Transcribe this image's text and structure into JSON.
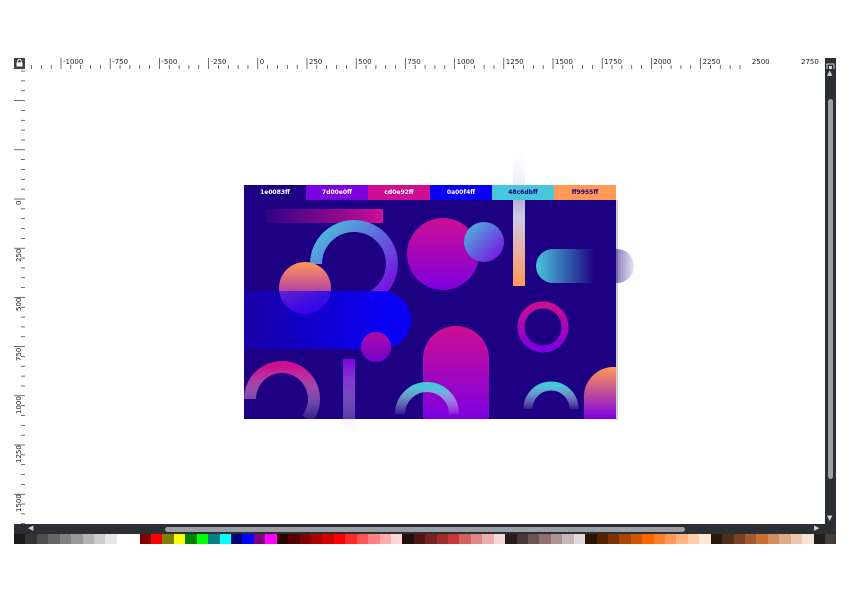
{
  "ruler": {
    "h_labels": [
      "-1000",
      "-750",
      "-500",
      "-250",
      "0",
      "250",
      "500",
      "750",
      "1000",
      "1250",
      "1500",
      "1750",
      "2000",
      "2250",
      "2500",
      "2750"
    ],
    "v_labels": [
      "0",
      "250",
      "500",
      "750",
      "1000",
      "1250",
      "1500",
      "1750",
      "2000"
    ]
  },
  "tabs": [
    {
      "label": "1e0083ff",
      "bg": "#1e0083",
      "fg": "#ffffff"
    },
    {
      "label": "7d00e0ff",
      "bg": "#7d00e0",
      "fg": "#ffffff"
    },
    {
      "label": "cd0e92ff",
      "bg": "#cd0e92",
      "fg": "#ffffff"
    },
    {
      "label": "0a00f4ff",
      "bg": "#0a00f4",
      "fg": "#ffffff"
    },
    {
      "label": "48c6dbff",
      "bg": "#48c6db",
      "fg": "#1e0083"
    },
    {
      "label": "ff9955ff",
      "bg": "#ff9955",
      "fg": "#1e0083"
    }
  ],
  "colors": {
    "artboard": "#1e0083",
    "purple": "#7d00e0",
    "magenta": "#cd0e92",
    "blue": "#0a00f4",
    "cyan": "#48c6db",
    "orange": "#ff9955"
  },
  "palette": [
    "#1a1a1a",
    "#333333",
    "#4d4d4d",
    "#666666",
    "#808080",
    "#999999",
    "#b3b3b3",
    "#cccccc",
    "#e6e6e6",
    "#ffffff",
    "#ffffff",
    "#800000",
    "#ff0000",
    "#808000",
    "#ffff00",
    "#008000",
    "#00ff00",
    "#008080",
    "#00ffff",
    "#000080",
    "#0000ff",
    "#800080",
    "#ff00ff",
    "#2b0000",
    "#550000",
    "#800000",
    "#aa0000",
    "#d40000",
    "#ff0000",
    "#ff2a2a",
    "#ff5555",
    "#ff8080",
    "#ffaaaa",
    "#ffd5d5",
    "#280b0b",
    "#501616",
    "#782121",
    "#a02c2c",
    "#c83737",
    "#d35f5f",
    "#de8787",
    "#e9afaf",
    "#f4d7d7",
    "#241c1c",
    "#483737",
    "#6c5353",
    "#916f6f",
    "#ac9393",
    "#c8b7b7",
    "#e3dbdb",
    "#2b1100",
    "#552200",
    "#803300",
    "#aa4400",
    "#d45500",
    "#ff6600",
    "#ff7f2a",
    "#ff9955",
    "#ffb380",
    "#ffccaa",
    "#ffe6d5",
    "#28170b",
    "#502d16",
    "#784421",
    "#a05a2c",
    "#c87137",
    "#d38d5f",
    "#deaa87",
    "#e9c6af",
    "#f4e3d7",
    "#241f1c",
    "#483e37"
  ]
}
